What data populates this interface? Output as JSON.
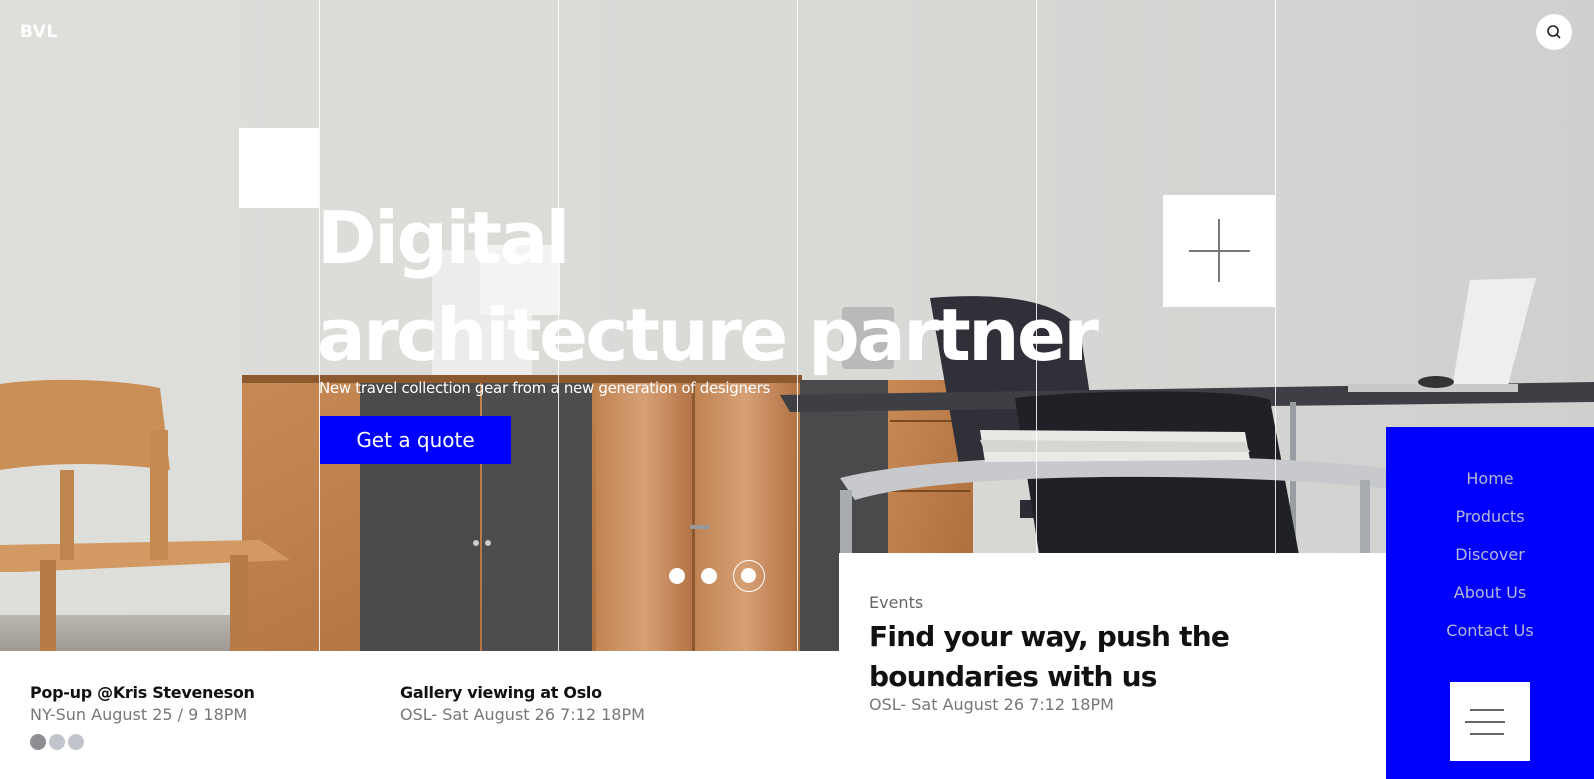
{
  "brand": {
    "logo": "BVL",
    "accent_color": "#0000ff"
  },
  "header": {
    "search_icon": "search-icon"
  },
  "hero": {
    "headline_line1": "Digital",
    "headline_line2": "architecture partner",
    "subtitle": "New travel collection gear from a new generation of designers",
    "cta_label": "Get a quote",
    "slides": {
      "count": 3,
      "active_index": 3
    },
    "plus_icon": "plus-icon"
  },
  "events": {
    "label": "Events",
    "title": "Find your way, push the boundaries with us",
    "date": "OSL- Sat August 26 7:12 18PM"
  },
  "nav": {
    "items": [
      {
        "label": "Home"
      },
      {
        "label": "Products"
      },
      {
        "label": "Discover"
      },
      {
        "label": "About Us"
      },
      {
        "label": "Contact Us"
      }
    ],
    "menu_icon": "menu-icon"
  },
  "bottom_events": [
    {
      "title": "Pop-up @Kris Steveneson",
      "date": "NY-Sun August 25 / 9 18PM"
    },
    {
      "title": "Gallery viewing at Oslo",
      "date": "OSL- Sat August 26 7:12 18PM"
    }
  ],
  "bottom_pager": {
    "count": 3,
    "active_index": 1
  }
}
